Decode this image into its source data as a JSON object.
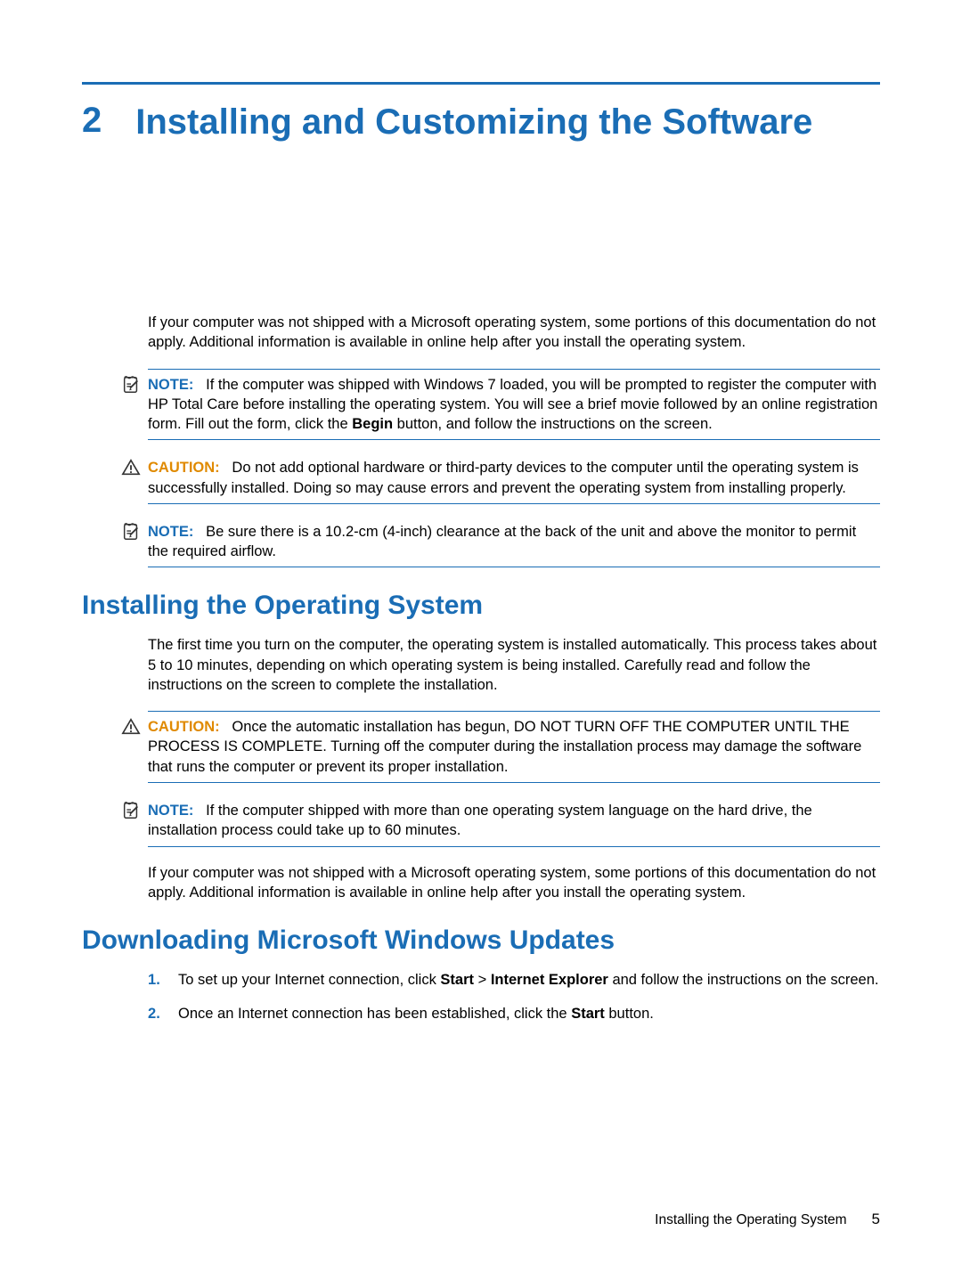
{
  "chapter": {
    "number": "2",
    "title": "Installing and Customizing the Software"
  },
  "intro_para": "If your computer was not shipped with a Microsoft operating system, some portions of this documentation do not apply. Additional information is available in online help after you install the operating system.",
  "callouts": {
    "note1": {
      "label": "NOTE:",
      "text_a": "If the computer was shipped with Windows 7 loaded, you will be prompted to register the computer with HP Total Care before installing the operating system. You will see a brief movie followed by an online registration form. Fill out the form, click the ",
      "bold1": "Begin",
      "text_b": " button, and follow the instructions on the screen."
    },
    "caution1": {
      "label": "CAUTION:",
      "text": "Do not add optional hardware or third-party devices to the computer until the operating system is successfully installed. Doing so may cause errors and prevent the operating system from installing properly."
    },
    "note2": {
      "label": "NOTE:",
      "text": "Be sure there is a 10.2-cm (4-inch) clearance at the back of the unit and above the monitor to permit the required airflow."
    },
    "caution2": {
      "label": "CAUTION:",
      "text": "Once the automatic installation has begun, DO NOT TURN OFF THE COMPUTER UNTIL THE PROCESS IS COMPLETE. Turning off the computer during the installation process may damage the software that runs the computer or prevent its proper installation."
    },
    "note3": {
      "label": "NOTE:",
      "text": "If the computer shipped with more than one operating system language on the hard drive, the installation process could take up to 60 minutes."
    }
  },
  "section_install": {
    "heading": "Installing the Operating System",
    "para1": "The first time you turn on the computer, the operating system is installed automatically. This process takes about 5 to 10 minutes, depending on which operating system is being installed. Carefully read and follow the instructions on the screen to complete the installation.",
    "para2": "If your computer was not shipped with a Microsoft operating system, some portions of this documentation do not apply. Additional information is available in online help after you install the operating system."
  },
  "section_updates": {
    "heading": "Downloading Microsoft Windows Updates",
    "step1_a": "To set up your Internet connection, click ",
    "step1_b1": "Start",
    "step1_gt": " > ",
    "step1_b2": "Internet Explorer",
    "step1_c": " and follow the instructions on the screen.",
    "step2_a": "Once an Internet connection has been established, click the ",
    "step2_b": "Start",
    "step2_c": " button."
  },
  "footer": {
    "label": "Installing the Operating System",
    "page": "5"
  }
}
